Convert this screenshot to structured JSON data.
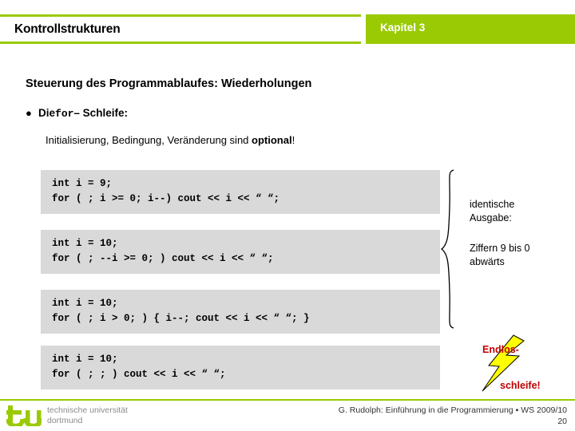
{
  "header": {
    "title": "Kontrollstrukturen",
    "chapter": "Kapitel 3",
    "accent_color": "#9aca03"
  },
  "slide": {
    "heading": "Steuerung des Programmablaufes: Wiederholungen",
    "bullet": {
      "marker": "bullet-icon",
      "prefix": "Die ",
      "keyword": "for",
      "suffix": " – Schleife:"
    },
    "subnote": {
      "lead": "Initialisierung, Bedingung, Veränderung sind ",
      "emphasis": "optional",
      "trail": "!"
    }
  },
  "code_blocks": [
    {
      "id": "code-block-0",
      "lines": [
        "int i = 9;",
        "for ( ; i >= 0; i--) cout << i << “ “;"
      ]
    },
    {
      "id": "code-block-1",
      "lines": [
        "int i = 10;",
        "for ( ; --i >= 0; ) cout << i << “ “;"
      ]
    },
    {
      "id": "code-block-2",
      "lines": [
        "int i = 10;",
        "for ( ; i > 0; ) { i--; cout << i << “ “; }"
      ]
    },
    {
      "id": "code-block-3",
      "lines": [
        "int i = 10;",
        "for ( ; ; ) cout << i << “ “;"
      ]
    }
  ],
  "annotations": {
    "brace_icon": "curly-brace-icon",
    "identical_output": "identische\nAusgabe:",
    "digits_note": "Ziffern 9 bis 0\nabwärts",
    "endless_loop": {
      "part1": "Endlos-",
      "part2": "schleife!",
      "color": "#c00000",
      "bolt_icon": "lightning-bolt-icon",
      "bolt_color": "#ffff00"
    }
  },
  "footer": {
    "logo_mark": "tu-dortmund-logo-icon",
    "logo_line1": "technische universität",
    "logo_line2": "dortmund",
    "credit": "G. Rudolph: Einführung in die Programmierung ▪ WS 2009/10",
    "page_number": "20"
  }
}
